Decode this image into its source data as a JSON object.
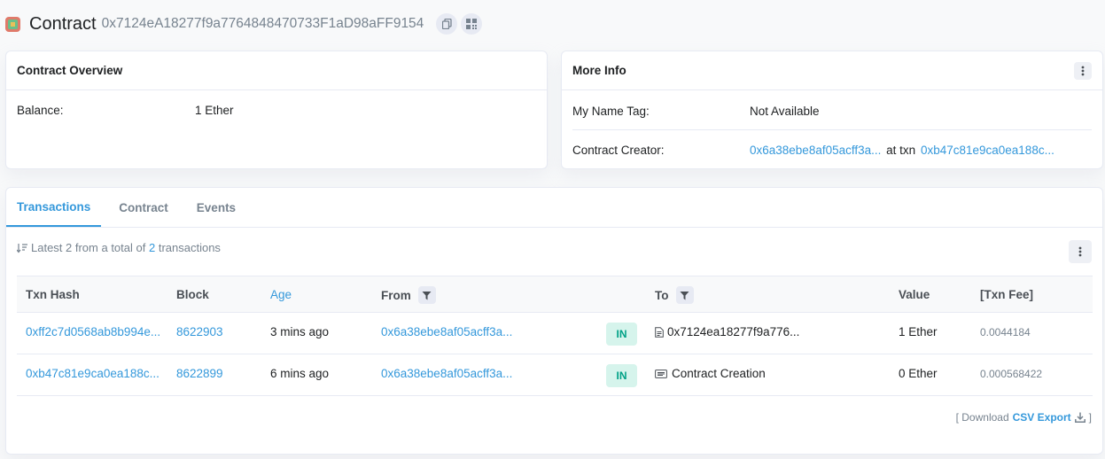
{
  "header": {
    "title": "Contract",
    "address": "0x7124eA18277f9a7764848470733F1aD98aFF9154"
  },
  "overview": {
    "title": "Contract Overview",
    "balance_label": "Balance:",
    "balance_value": "1 Ether"
  },
  "more_info": {
    "title": "More Info",
    "name_tag_label": "My Name Tag:",
    "name_tag_value": "Not Available",
    "creator_label": "Contract Creator:",
    "creator_address": "0x6a38ebe8af05acff3a...",
    "at_txn": "at txn",
    "creator_txn": "0xb47c81e9ca0ea188c..."
  },
  "tabs": [
    "Transactions",
    "Contract",
    "Events"
  ],
  "summary": {
    "prefix": "Latest 2 from a total of",
    "count": "2",
    "suffix": "transactions"
  },
  "columns": {
    "hash": "Txn Hash",
    "block": "Block",
    "age": "Age",
    "from": "From",
    "to": "To",
    "value": "Value",
    "fee": "[Txn Fee]"
  },
  "rows": [
    {
      "hash": "0xff2c7d0568ab8b994e...",
      "block": "8622903",
      "age": "3 mins ago",
      "from": "0x6a38ebe8af05acff3a...",
      "direction": "IN",
      "to": "0x7124ea18277f9a776...",
      "value": "1 Ether",
      "fee": "0.0044184"
    },
    {
      "hash": "0xb47c81e9ca0ea188c...",
      "block": "8622899",
      "age": "6 mins ago",
      "from": "0x6a38ebe8af05acff3a...",
      "direction": "IN",
      "to": "Contract Creation",
      "value": "0 Ether",
      "fee": "0.000568422"
    }
  ],
  "download": {
    "open": "[ Download",
    "csv": "CSV Export",
    "close": "]"
  },
  "colors": {
    "link": "#3498db",
    "in_badge_bg": "#d6f4ec",
    "in_badge_text": "#00a186"
  }
}
